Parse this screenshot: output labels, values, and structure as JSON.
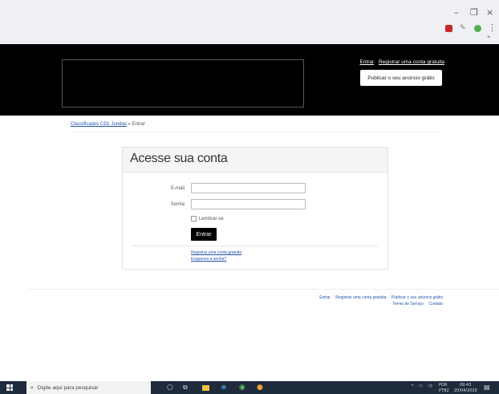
{
  "window": {
    "minimize": "–",
    "restore": "❐",
    "close": "×",
    "more": "⋮",
    "overflow": "»"
  },
  "header": {
    "login_link": "Entrar",
    "register_link": "Registrar uma conta gratuita",
    "publish_button": "Publicar o seu anúncio grátis"
  },
  "breadcrumb": {
    "home": "Classificados CDL Jundiaí",
    "separator": "»",
    "current": "Entrar"
  },
  "login": {
    "title": "Acesse sua conta",
    "email_label": "E-mail",
    "email_value": "",
    "password_label": "Senha",
    "password_value": "",
    "remember_label": "Lembrar-se",
    "submit_label": "Entrar",
    "register_link": "Registrar uma conta gratuita",
    "forgot_link": "Esqueceu a senha?"
  },
  "footer": {
    "login": "Entrar",
    "register": "Registrar uma conta gratuita",
    "publish": "Publicar o seu anúncio grátis",
    "terms": "Termo de Serviço",
    "contact": "Contato"
  },
  "taskbar": {
    "search_placeholder": "Digite aqui para pesquisar",
    "language": "POR",
    "layout": "PTB2",
    "time": "09:43",
    "date": "20/04/2020"
  },
  "colors": {
    "header_bg": "#000000",
    "link": "#2255aa",
    "taskbar_bg": "#1e2b3c"
  }
}
